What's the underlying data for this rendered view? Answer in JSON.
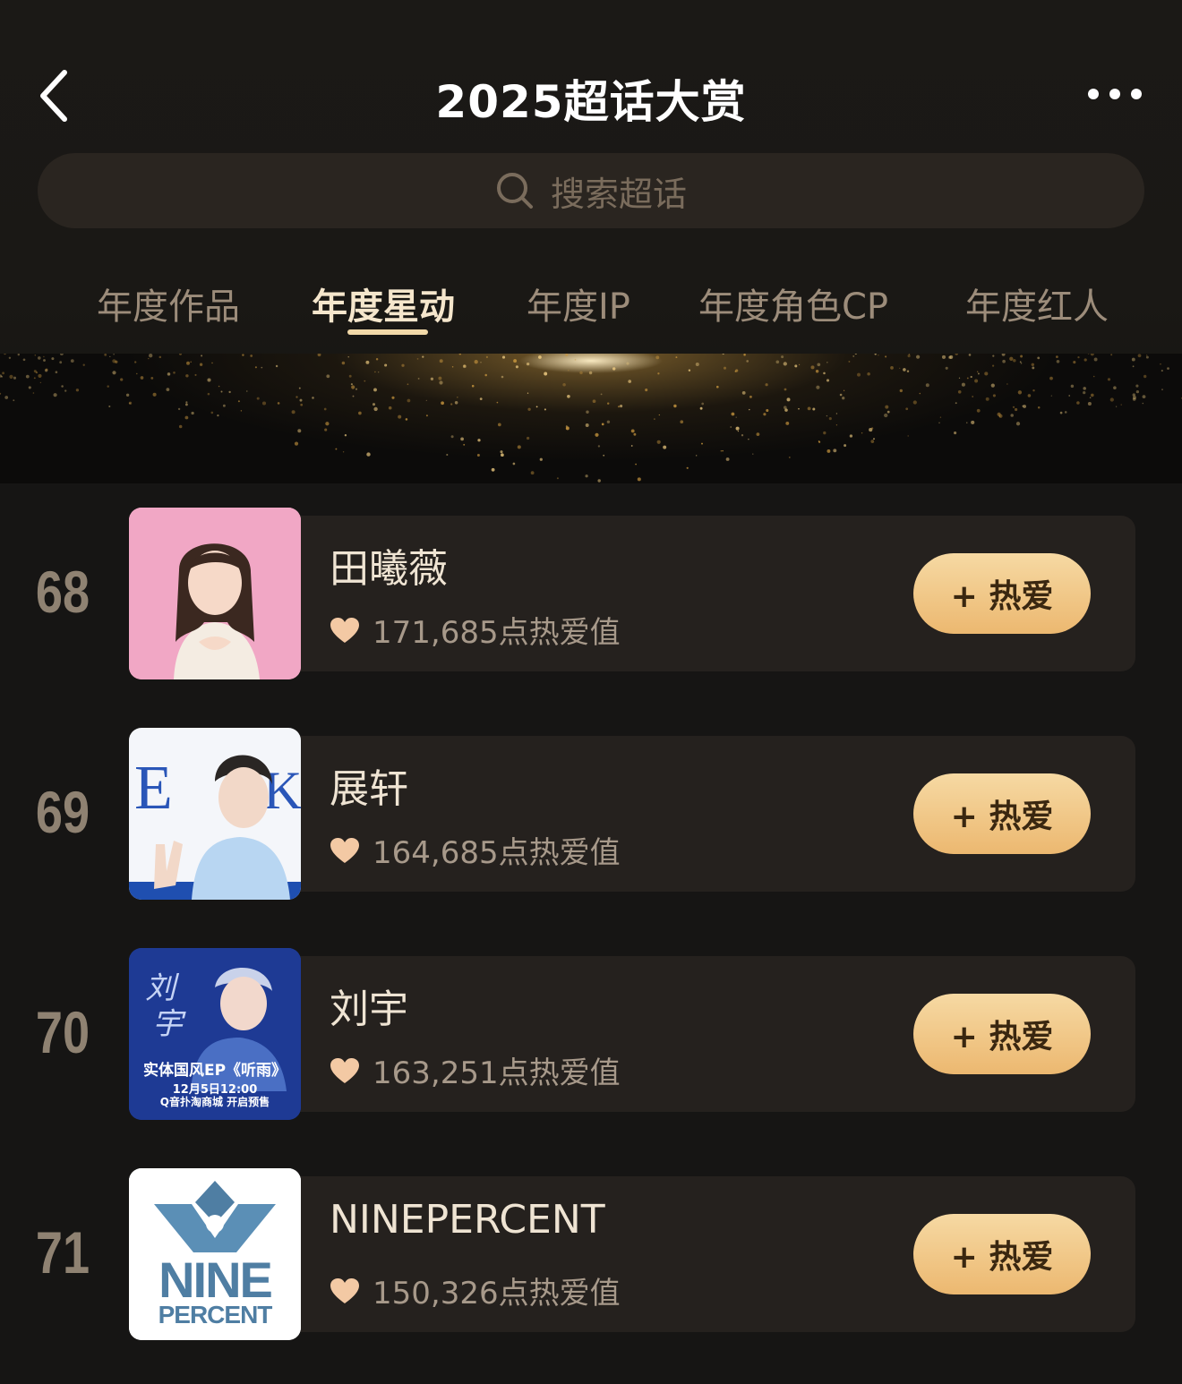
{
  "header": {
    "title": "2025超话大赏",
    "search_placeholder": "搜索超话"
  },
  "tabs": [
    {
      "label": "年度作品",
      "active": false
    },
    {
      "label": "年度星动",
      "active": true
    },
    {
      "label": "年度IP",
      "active": false
    },
    {
      "label": "年度角色CP",
      "active": false
    },
    {
      "label": "年度红人",
      "active": false
    }
  ],
  "colors": {
    "background": "#161514",
    "card": "#25211e",
    "accent_gold": "#ecb870",
    "heart": "#f3c9a4"
  },
  "icons": {
    "back": "chevron-left-icon",
    "more": "more-dots-icon",
    "search": "search-icon",
    "heart": "heart-icon"
  },
  "ranking": [
    {
      "rank": "68",
      "name": "田曦薇",
      "score": "171,685点热爱值",
      "button": "+ 热爱",
      "thumb_style": "pink-portrait"
    },
    {
      "rank": "69",
      "name": "展轩",
      "score": "164,685点热爱值",
      "button": "+ 热爱",
      "thumb_style": "blue-portrait"
    },
    {
      "rank": "70",
      "name": "刘宇",
      "score": "163,251点热爱值",
      "button": "+ 热爱",
      "thumb_style": "navy-poster"
    },
    {
      "rank": "71",
      "name": "NINEPERCENT",
      "score": "150,326点热爱值",
      "button": "+ 热爱",
      "thumb_style": "nine-percent-logo"
    }
  ],
  "posters": {
    "liuyu_line1": "实体国风EP《听雨》",
    "liuyu_line2": "12月5日12:00",
    "liuyu_line3": "Q音扑淘商城 开启预售",
    "nine": "NINE",
    "percent": "PERCENT"
  }
}
